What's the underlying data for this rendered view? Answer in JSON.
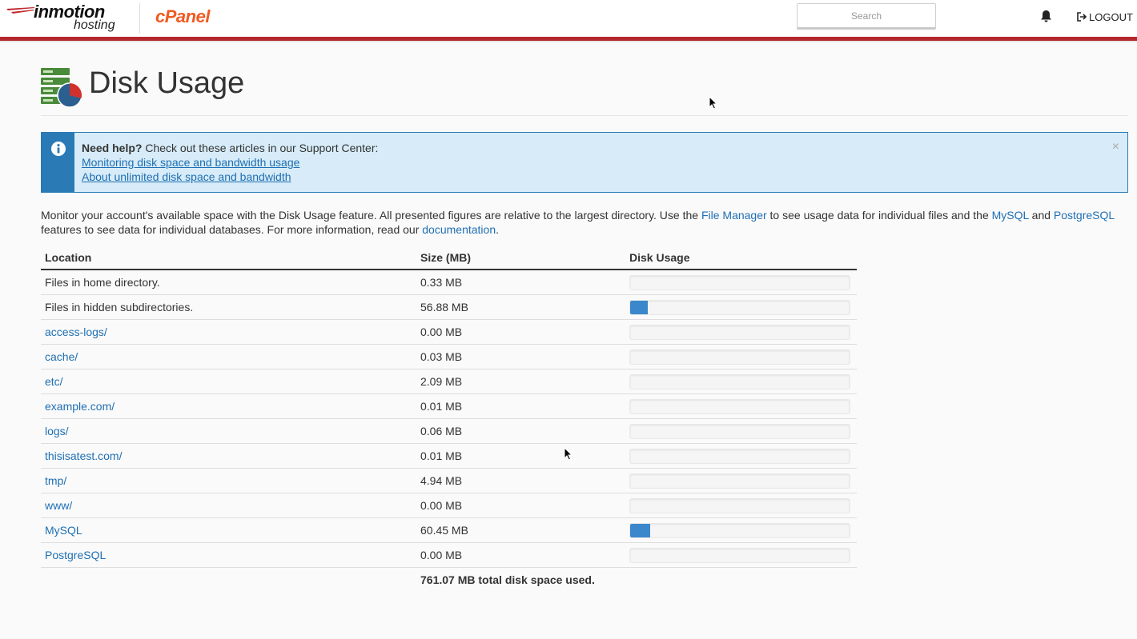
{
  "header": {
    "logo_primary": "inmotion",
    "logo_secondary": "hosting",
    "logo_cpanel": "cPanel",
    "search_placeholder": "Search",
    "logout_label": "LOGOUT",
    "accent_color": "#b3282d"
  },
  "page": {
    "title": "Disk Usage",
    "icon": "disk-usage-icon"
  },
  "help": {
    "lead_bold": "Need help?",
    "lead_text": " Check out these articles in our Support Center:",
    "links": [
      "Monitoring disk space and bandwidth usage",
      "About unlimited disk space and bandwidth"
    ],
    "close_label": "×"
  },
  "description": {
    "part1": "Monitor your account's available space with the Disk Usage feature. All presented figures are relative to the largest directory. Use the ",
    "link_file_manager": "File Manager",
    "part2": " to see usage data for individual files and the ",
    "link_mysql": "MySQL",
    "part3": " and ",
    "link_postgresql": "PostgreSQL",
    "part4": " features to see data for individual databases. For more information, read our ",
    "link_documentation": "documentation",
    "part5": "."
  },
  "table": {
    "headers": {
      "location": "Location",
      "size": "Size (MB)",
      "usage": "Disk Usage"
    },
    "rows": [
      {
        "location": "Files in home directory.",
        "is_link": false,
        "size": "0.33 MB",
        "usage_fraction": 0.0
      },
      {
        "location": "Files in hidden subdirectories.",
        "is_link": false,
        "size": "56.88 MB",
        "usage_fraction": 0.08
      },
      {
        "location": "access-logs/",
        "is_link": true,
        "size": "0.00 MB",
        "usage_fraction": 0.0
      },
      {
        "location": "cache/",
        "is_link": true,
        "size": "0.03 MB",
        "usage_fraction": 0.0
      },
      {
        "location": "etc/",
        "is_link": true,
        "size": "2.09 MB",
        "usage_fraction": 0.0
      },
      {
        "location": "example.com/",
        "is_link": true,
        "size": "0.01 MB",
        "usage_fraction": 0.0
      },
      {
        "location": "logs/",
        "is_link": true,
        "size": "0.06 MB",
        "usage_fraction": 0.0
      },
      {
        "location": "thisisatest.com/",
        "is_link": true,
        "size": "0.01 MB",
        "usage_fraction": 0.0
      },
      {
        "location": "tmp/",
        "is_link": true,
        "size": "4.94 MB",
        "usage_fraction": 0.0
      },
      {
        "location": "www/",
        "is_link": true,
        "size": "0.00 MB",
        "usage_fraction": 0.0
      },
      {
        "location": "MySQL",
        "is_link": true,
        "size": "60.45 MB",
        "usage_fraction": 0.09
      },
      {
        "location": "PostgreSQL",
        "is_link": true,
        "size": "0.00 MB",
        "usage_fraction": 0.0
      }
    ],
    "total": "761.07 MB total disk space used."
  }
}
